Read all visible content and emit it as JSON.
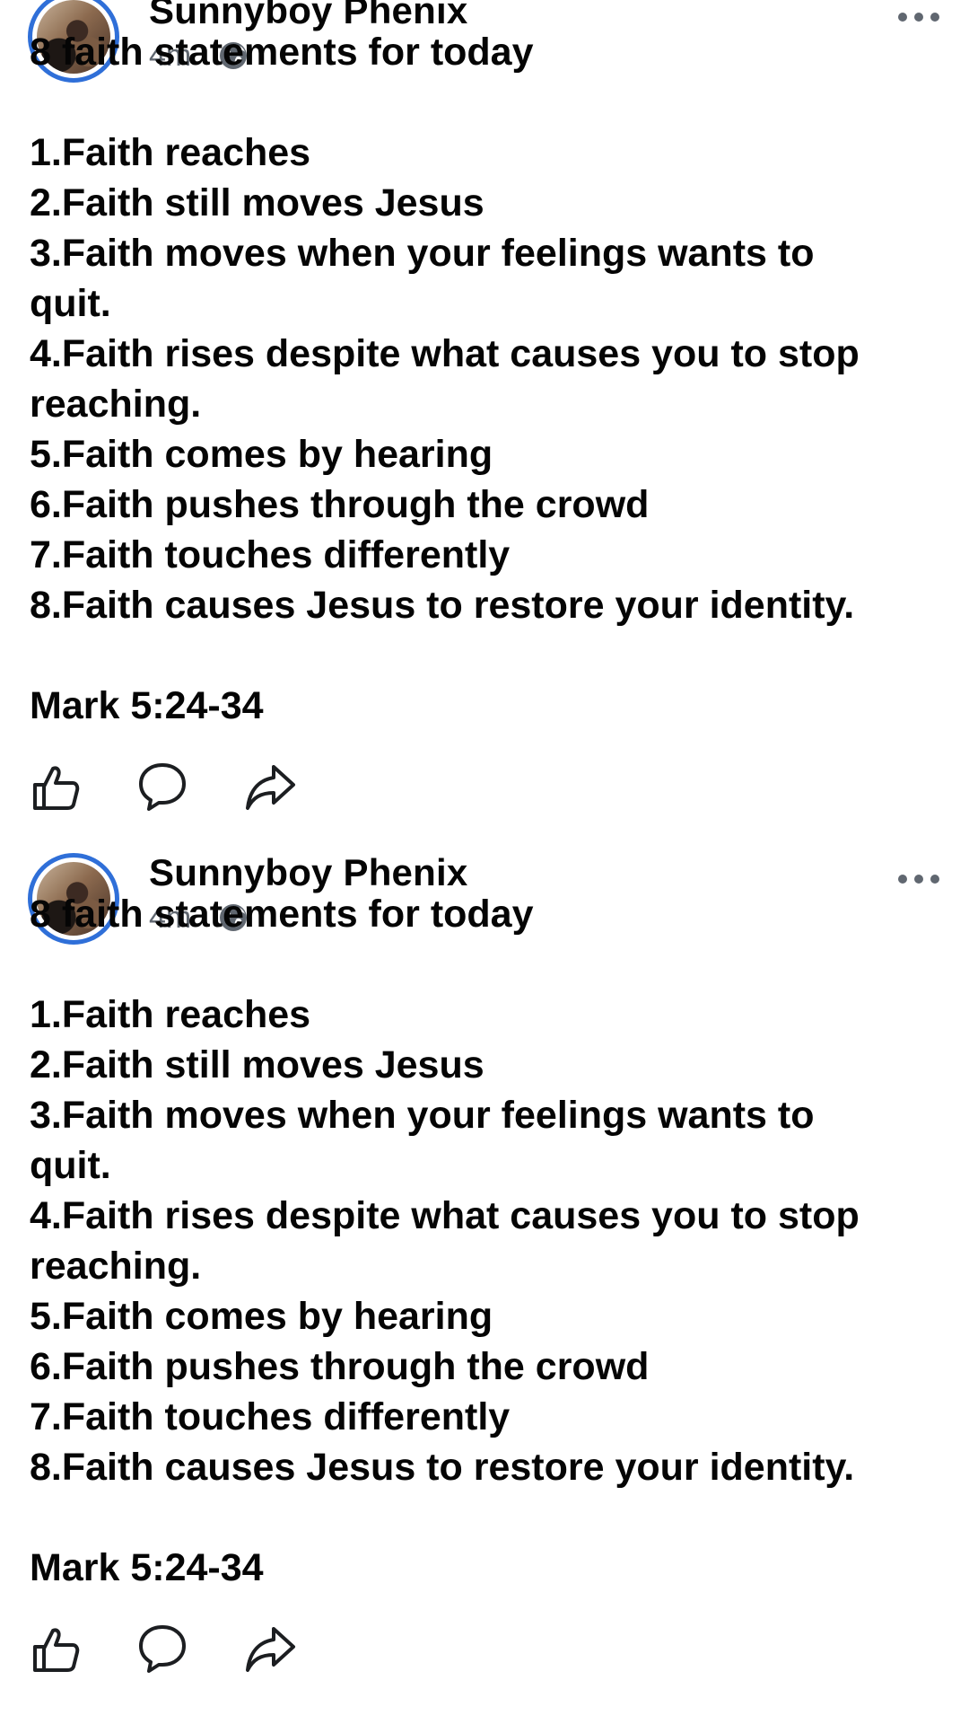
{
  "posts": [
    {
      "author": "Sunnyboy Phenix",
      "time": "4m",
      "separator": "·",
      "privacy_icon": "globe-icon",
      "title": "8 faith statements for today",
      "lines": [
        "1.Faith reaches",
        "2.Faith still moves Jesus",
        "3.Faith moves when your feelings wants to",
        "quit.",
        "4.Faith rises despite what causes you to stop",
        "reaching.",
        "5.Faith comes by hearing",
        "6.Faith pushes through the crowd",
        "7.Faith touches differently",
        "8.Faith causes Jesus to restore your identity."
      ],
      "reference": "Mark 5:24-34",
      "actions": [
        "like-icon",
        "comment-icon",
        "share-icon"
      ]
    },
    {
      "author": "Sunnyboy Phenix",
      "time": "4m",
      "separator": "·",
      "privacy_icon": "globe-icon",
      "title": "8 faith statements for today",
      "lines": [
        "1.Faith reaches",
        "2.Faith still moves Jesus",
        "3.Faith moves when your feelings wants to",
        "quit.",
        "4.Faith rises despite what causes you to stop",
        "reaching.",
        "5.Faith comes by hearing",
        "6.Faith pushes through the crowd",
        "7.Faith touches differently",
        "8.Faith causes Jesus to restore your identity."
      ],
      "reference": "Mark 5:24-34",
      "actions": [
        "like-icon",
        "comment-icon",
        "share-icon"
      ]
    }
  ],
  "colors": {
    "avatar_ring": "#2f6fd8",
    "meta_text": "#606770",
    "body_text": "#050505"
  }
}
